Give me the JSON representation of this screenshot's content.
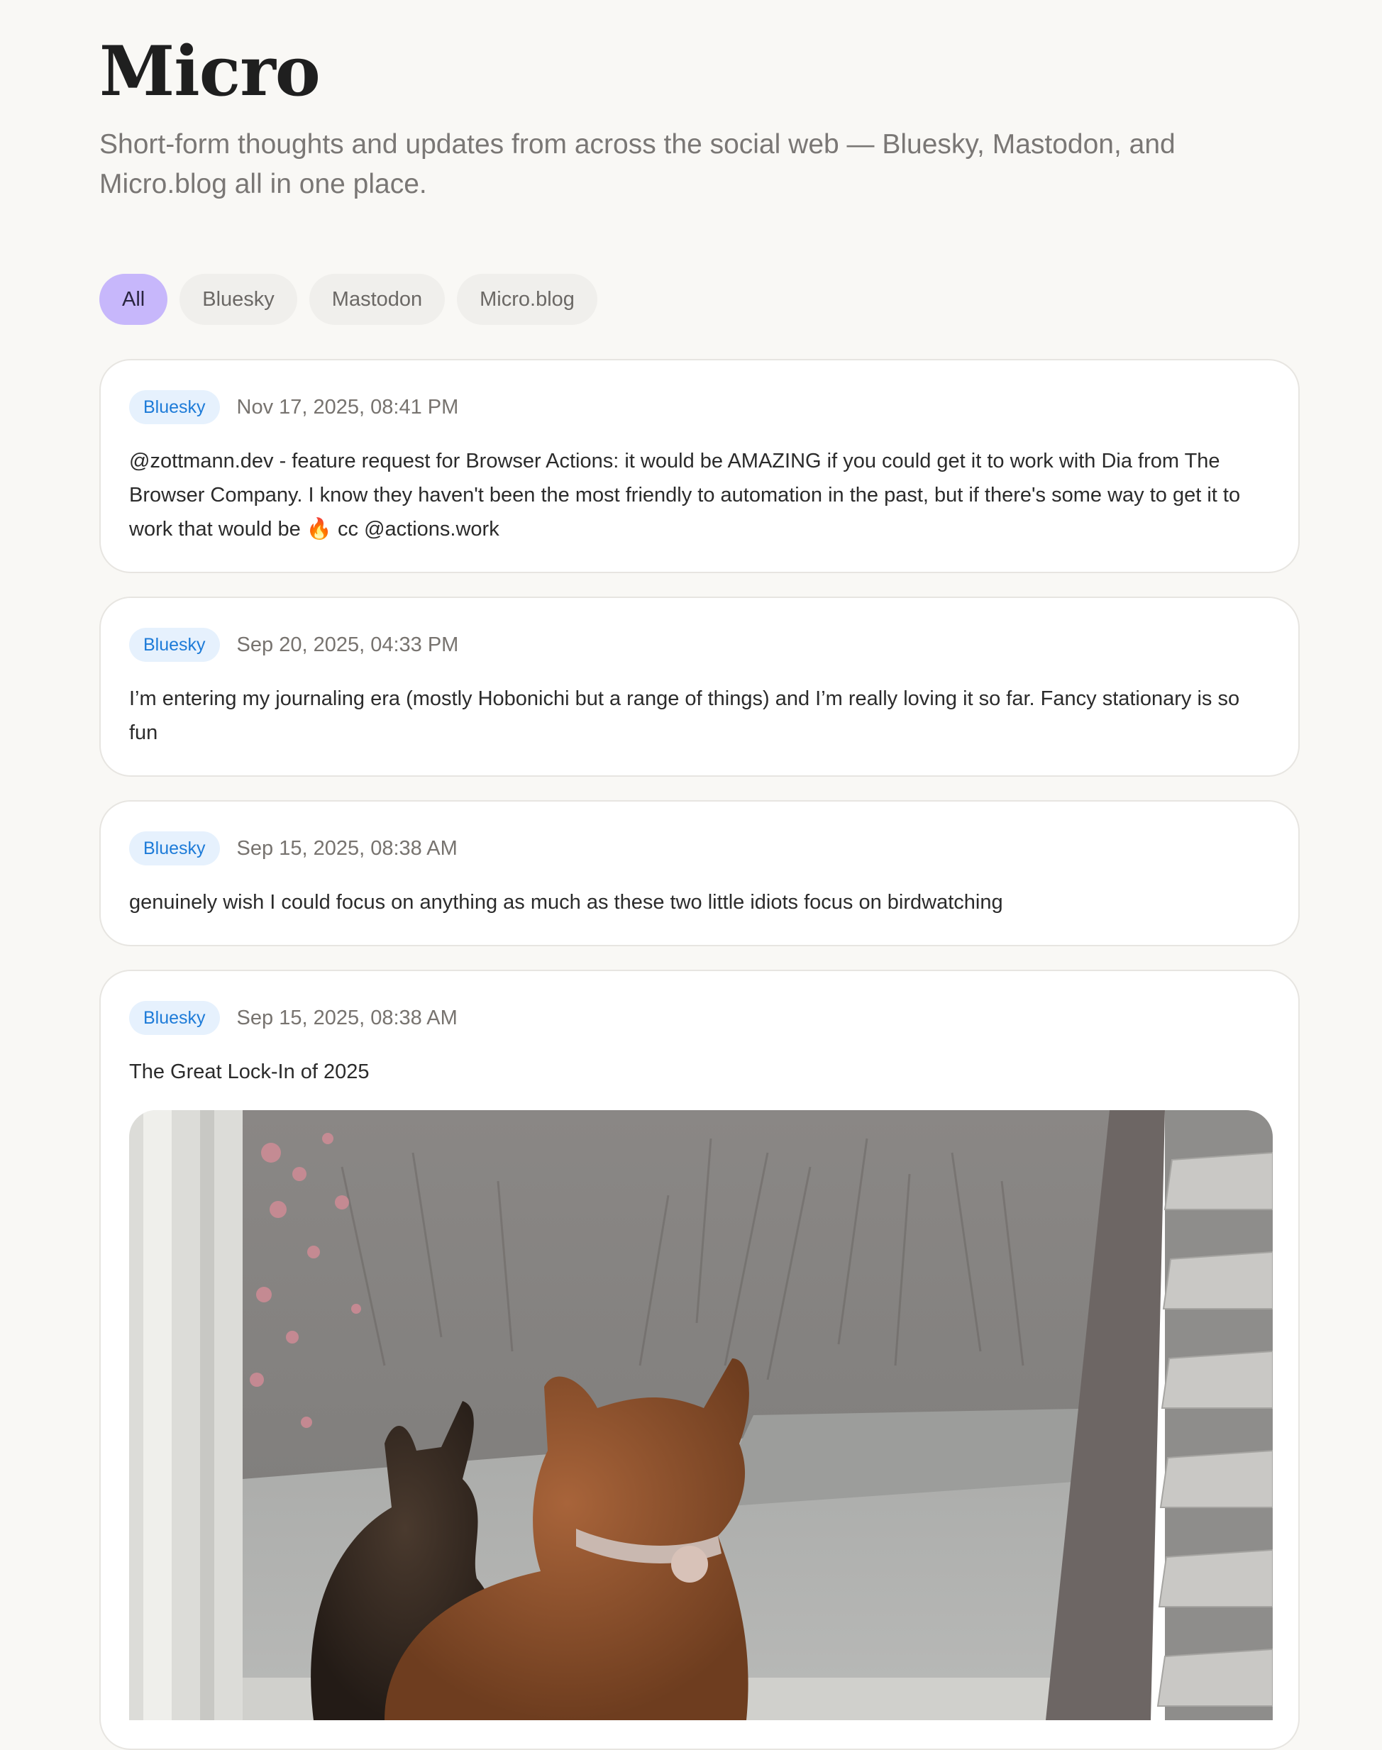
{
  "header": {
    "title": "Micro",
    "subtitle": "Short-form thoughts and updates from across the social web — Bluesky, Mastodon, and Micro.blog all in one place."
  },
  "filters": [
    {
      "label": "All",
      "active": true
    },
    {
      "label": "Bluesky",
      "active": false
    },
    {
      "label": "Mastodon",
      "active": false
    },
    {
      "label": "Micro.blog",
      "active": false
    }
  ],
  "posts": [
    {
      "source": "Bluesky",
      "timestamp": "Nov 17, 2025, 08:41 PM",
      "text": "@zottmann.dev - feature request for Browser Actions: it would be AMAZING if you could get it to work with Dia from The Browser Company. I know they haven't been the most friendly to automation in the past, but if there's some way to get it to work that would be 🔥 cc @actions.work"
    },
    {
      "source": "Bluesky",
      "timestamp": "Sep 20, 2025, 04:33 PM",
      "text": "I’m entering my journaling era (mostly Hobonichi but a range of things) and I’m really loving it so far. Fancy stationary is so fun"
    },
    {
      "source": "Bluesky",
      "timestamp": "Sep 15, 2025, 08:38 AM",
      "text": "genuinely wish I could focus on anything as much as these two little idiots focus on birdwatching"
    },
    {
      "source": "Bluesky",
      "timestamp": "Sep 15, 2025, 08:38 AM",
      "text": "The Great Lock-In of 2025",
      "image": "photo of two cats looking out a window"
    }
  ],
  "colors": {
    "background": "#f9f8f5",
    "active_filter": "#c7b7fb",
    "bluesky_badge_bg": "#e6f1fd",
    "bluesky_badge_text": "#1d7bd8"
  }
}
